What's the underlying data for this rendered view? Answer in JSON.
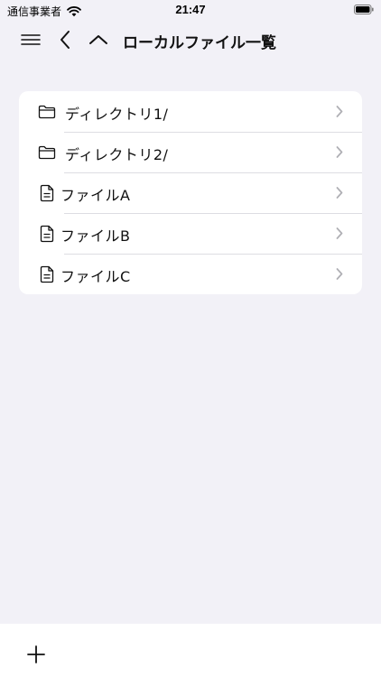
{
  "status_bar": {
    "carrier": "通信事業者",
    "time": "21:47",
    "wifi_icon": "wifi-icon",
    "battery_icon": "battery-icon"
  },
  "nav": {
    "title": "ローカルファイル一覧",
    "menu_icon": "menu-icon",
    "back_icon": "chevron-left-icon",
    "up_icon": "chevron-up-icon"
  },
  "items": [
    {
      "label": "ディレクトリ1/",
      "kind": "folder",
      "icon": "folder-icon"
    },
    {
      "label": "ディレクトリ2/",
      "kind": "folder",
      "icon": "folder-icon"
    },
    {
      "label": "ファイルA",
      "kind": "file",
      "icon": "document-icon"
    },
    {
      "label": "ファイルB",
      "kind": "file",
      "icon": "document-icon"
    },
    {
      "label": "ファイルC",
      "kind": "file",
      "icon": "document-icon"
    }
  ],
  "toolbar": {
    "add_icon": "plus-icon"
  },
  "colors": {
    "background": "#f2f1f7",
    "card": "#ffffff",
    "separator": "#dddde2",
    "chevron": "#b0b0b5",
    "text": "#111111"
  }
}
